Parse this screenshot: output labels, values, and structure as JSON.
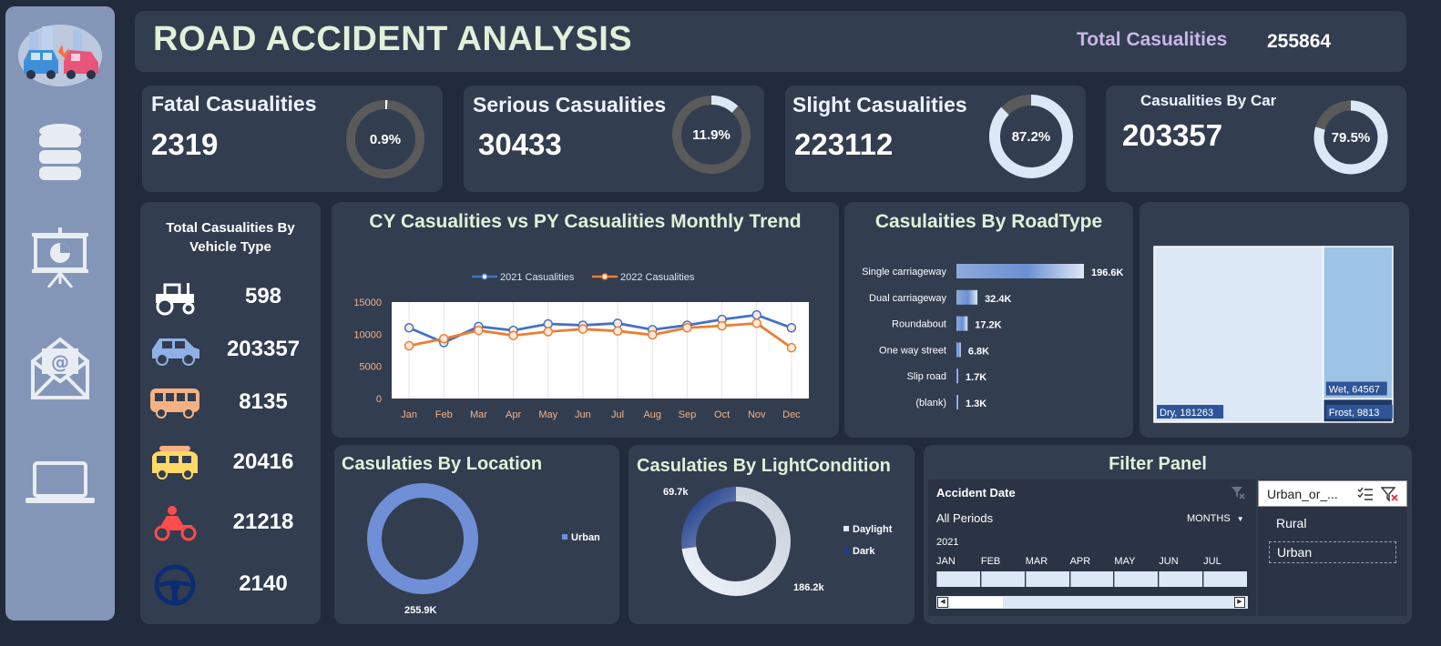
{
  "header": {
    "title": "ROAD ACCIDENT ANALYSIS",
    "total_label": "Total Casualities",
    "total_value": "255864"
  },
  "sidebar": {
    "icons": [
      "road-accident-icon",
      "database-icon",
      "presentation-icon",
      "mail-icon",
      "laptop-icon"
    ]
  },
  "kpis": {
    "fatal": {
      "title": "Fatal Casualities",
      "value": "2319",
      "pct_label": "0.9%",
      "pct": 0.9
    },
    "serious": {
      "title": "Serious Casualities",
      "value": "30433",
      "pct_label": "11.9%",
      "pct": 11.9
    },
    "slight": {
      "title": "Slight Casualities",
      "value": "223112",
      "pct_label": "87.2%",
      "pct": 87.2
    },
    "car": {
      "title": "Casualities By Car",
      "value": "203357",
      "pct_label": "79.5%",
      "pct": 79.5
    }
  },
  "vehicles": {
    "title_line1": "Total Casualities By",
    "title_line2": "Vehicle Type",
    "items": [
      {
        "icon": "tractor-icon",
        "value": "598"
      },
      {
        "icon": "car-icon",
        "value": "203357"
      },
      {
        "icon": "bus-icon",
        "value": "8135"
      },
      {
        "icon": "van-icon",
        "value": "20416"
      },
      {
        "icon": "motorcycle-icon",
        "value": "21218"
      },
      {
        "icon": "steering-wheel-icon",
        "value": "2140"
      }
    ]
  },
  "colors": {
    "cy_line": "#4472c4",
    "py_line": "#ed7d31",
    "accent_light": "#dde8f6",
    "donut_track": "#5a5a5a"
  },
  "trend": {
    "title": "CY  Casualities vs PY Casualities Monthly Trend",
    "chart_data": {
      "type": "line",
      "categories": [
        "Jan",
        "Feb",
        "Mar",
        "Apr",
        "May",
        "Jun",
        "Jul",
        "Aug",
        "Sep",
        "Oct",
        "Nov",
        "Dec"
      ],
      "series": [
        {
          "name": "2021 Casualities",
          "values": [
            11000,
            8700,
            11200,
            10600,
            11600,
            11400,
            11700,
            10700,
            11400,
            12300,
            13000,
            11000
          ]
        },
        {
          "name": "2022 Casualities",
          "values": [
            8200,
            9300,
            10600,
            9800,
            10400,
            10800,
            10500,
            9900,
            11000,
            11300,
            11700,
            7900
          ]
        }
      ],
      "ylim": [
        0,
        15000
      ],
      "yticks": [
        0,
        5000,
        10000,
        15000
      ],
      "legend": "top"
    }
  },
  "roadtype": {
    "title": "Casulaities By RoadType",
    "chart_data": {
      "type": "bar",
      "categories": [
        "Single carriageway",
        "Dual carriageway",
        "Roundabout",
        "One way street",
        "Slip road",
        "(blank)"
      ],
      "values": [
        196.6,
        32.4,
        17.2,
        6.8,
        1.7,
        1.3
      ],
      "value_labels": [
        "196.6K",
        "32.4K",
        "17.2K",
        "6.8K",
        "1.7K",
        "1.3K"
      ]
    }
  },
  "surface": {
    "chart_data": {
      "type": "treemap",
      "labels": [
        "Dry, 181263",
        "Wet, 64567",
        "Frost, 9813"
      ],
      "values": [
        181263,
        64567,
        9813
      ]
    }
  },
  "location": {
    "title": "Casulaties By Location",
    "chart_data": {
      "type": "pie",
      "labels": [
        "Urban"
      ],
      "values": [
        255.9
      ],
      "value_labels": [
        "255.9K"
      ]
    }
  },
  "light": {
    "title": "Casulaties By LightCondition",
    "chart_data": {
      "type": "pie",
      "labels": [
        "Daylight",
        "Dark"
      ],
      "values": [
        186.2,
        69.7
      ],
      "value_labels": [
        "186.2k",
        "69.7k"
      ]
    }
  },
  "filter": {
    "title": "Filter Panel",
    "timeline_title": "Accident Date",
    "period": "All Periods",
    "level": "MONTHS",
    "year": "2021",
    "months": [
      "JAN",
      "FEB",
      "MAR",
      "APR",
      "MAY",
      "JUN",
      "JUL"
    ],
    "slicer_title": "Urban_or_...",
    "slicer_items": [
      "Rural",
      "Urban"
    ]
  }
}
